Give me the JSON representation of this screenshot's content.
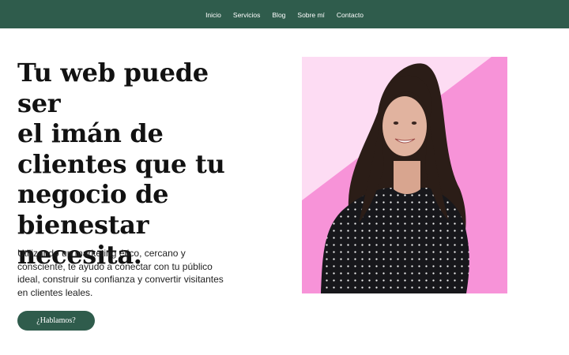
{
  "nav": {
    "items": [
      {
        "label": "Inicio"
      },
      {
        "label": "Servicios"
      },
      {
        "label": "Blog"
      },
      {
        "label": "Sobre mí"
      },
      {
        "label": "Contacto"
      }
    ]
  },
  "hero": {
    "title_lines": [
      "Tu web puede ser",
      "el imán de",
      "clientes que tu",
      "negocio de",
      "bienestar",
      "necesita."
    ],
    "description": "Utilizando un marketing ético, cercano y consciente, te ayudo a conectar con tu público ideal, construir su confianza y convertir visitantes en clientes leales.",
    "cta_label": "¿Hablamos?"
  },
  "colors": {
    "nav_background": "#2f5c4c",
    "cta_background": "#2f5c4c",
    "photo_pink": "#f793d8",
    "photo_light_pink": "#fddcf3"
  },
  "icons": {
    "photo": "woman-portrait-photo"
  }
}
